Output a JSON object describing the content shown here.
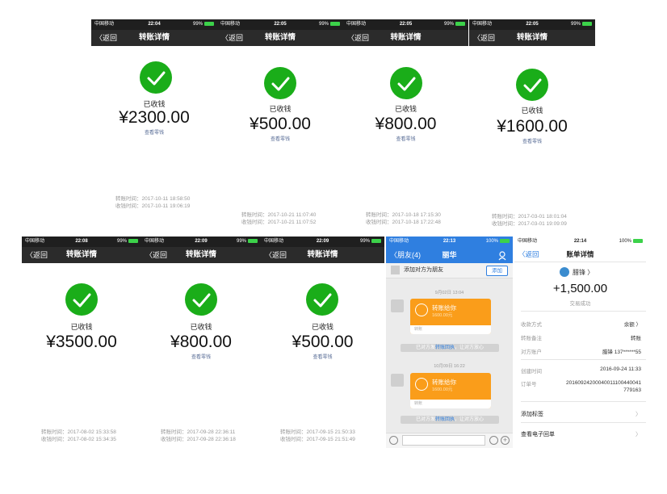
{
  "status": {
    "carrier": "中国移动",
    "battery_99": "99%",
    "battery_100": "100%"
  },
  "nav": {
    "back": "〈返回",
    "title": "转账详情"
  },
  "labels": {
    "received": "已收钱",
    "view_change": "查看零钱"
  },
  "transfers": [
    {
      "time": "22:04",
      "amount": "¥2300.00",
      "transfer_time": "转账时间：2017-10-11 18:58:50",
      "receive_time": "收钱时间：2017-10-11 19:06:19"
    },
    {
      "time": "22:05",
      "amount": "¥500.00",
      "transfer_time": "转账时间：2017-10-21 11:07:40",
      "receive_time": "收钱时间：2017-10-21 11:07:52"
    },
    {
      "time": "22:05",
      "amount": "¥800.00",
      "transfer_time": "转账时间：2017-10-18 17:15:30",
      "receive_time": "收钱时间：2017-10-18 17:22:48"
    },
    {
      "time": "22:05",
      "amount": "¥1600.00",
      "transfer_time": "转账时间：2017-03-01 18:01:04",
      "receive_time": "收钱时间：2017-03-01 19:09:09"
    },
    {
      "time": "22:08",
      "amount": "¥3500.00",
      "transfer_time": "转账时间：2017-08-02 15:33:58",
      "receive_time": "收钱时间：2017-08-02 15:34:35"
    },
    {
      "time": "22:09",
      "amount": "¥800.00",
      "transfer_time": "转账时间：2017-09-28 22:36:11",
      "receive_time": "收钱时间：2017-09-28 22:36:18"
    },
    {
      "time": "22:09",
      "amount": "¥500.00",
      "transfer_time": "转账时间：2017-09-15 21:50:33",
      "receive_time": "收钱时间：2017-09-15 21:51:49"
    }
  ],
  "chat": {
    "time": "22:13",
    "back": "〈朋友(4)",
    "title": "丽华",
    "add_prompt": "添加对方为朋友",
    "add_button": "添加",
    "messages": [
      {
        "timestamp": "9月02日 13:04",
        "bubble_title": "转账给你",
        "bubble_amount": "1600.00元",
        "bubble_footer": "转账",
        "sys_prefix": "已对方发",
        "sys_link": "转账回执",
        "sys_suffix": "，让对方放心"
      },
      {
        "timestamp": "10月09日 16:22",
        "bubble_title": "转账给你",
        "bubble_amount": "1600.00元",
        "bubble_footer": "转账",
        "sys_prefix": "已对方发",
        "sys_link": "转账回执",
        "sys_suffix": "，让对方放心"
      }
    ]
  },
  "bill": {
    "time": "22:14",
    "back": "〈返回",
    "title": "账单详情",
    "name": "腊锋 〉",
    "amount": "+1,500.00",
    "status": "交易成功",
    "rows": [
      {
        "label": "收款方式",
        "value": "余额 〉"
      },
      {
        "label": "转账备注",
        "value": "转账"
      },
      {
        "label": "对方账户",
        "value": "腊锋 137******55"
      },
      {
        "label": "创建时间",
        "value": "2016-09-24 11:33"
      },
      {
        "label": "订单号",
        "value": "20160924200040011100440041",
        "value2": "779163"
      }
    ],
    "menu": [
      {
        "label": "添加标签",
        "chev": "〉"
      },
      {
        "label": "查看电子回单",
        "chev": "〉"
      }
    ]
  },
  "colors": {
    "wechat_green": "#1aad19",
    "alipay_blue": "#2f7fe0",
    "transfer_orange": "#fa9d1a"
  }
}
